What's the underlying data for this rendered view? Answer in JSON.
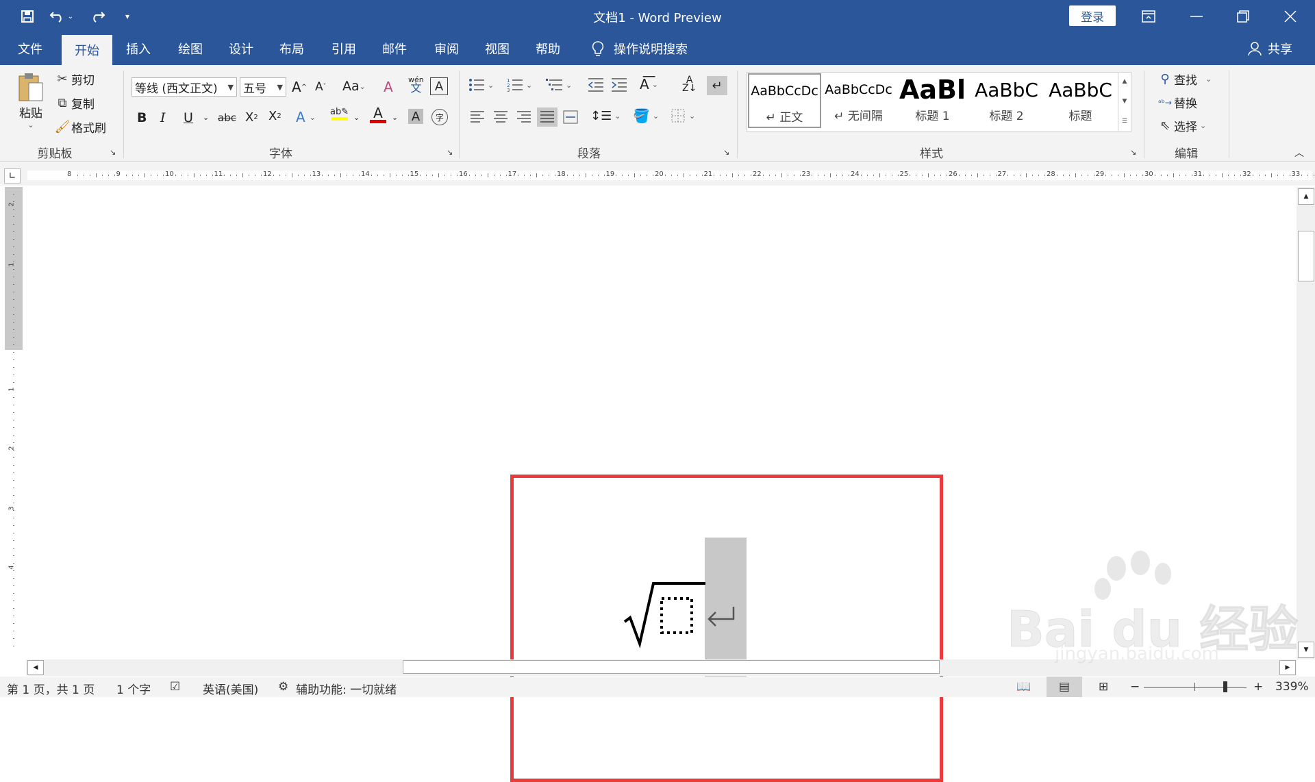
{
  "titlebar": {
    "title": "文档1  -  Word Preview",
    "login_label": "登录",
    "bg": "#2b579a"
  },
  "tabs": [
    "文件",
    "开始",
    "插入",
    "绘图",
    "设计",
    "布局",
    "引用",
    "邮件",
    "审阅",
    "视图",
    "帮助"
  ],
  "active_tab": "开始",
  "search_label": "操作说明搜索",
  "share_label": "共享",
  "clipboard": {
    "paste": "粘贴",
    "cut": "剪切",
    "copy": "复制",
    "format_painter": "格式刷",
    "group": "剪贴板"
  },
  "font": {
    "font_name": "等线 (西文正文)",
    "font_size": "五号",
    "change_case": "Aa",
    "group": "字体"
  },
  "paragraph": {
    "group": "段落"
  },
  "styles": {
    "group": "样式",
    "items": [
      {
        "sample": "AaBbCcDc",
        "name": "↵ 正文"
      },
      {
        "sample": "AaBbCcDc",
        "name": "↵ 无间隔"
      },
      {
        "sample": "AaBl",
        "name": "标题 1"
      },
      {
        "sample": "AaBbC",
        "name": "标题 2"
      },
      {
        "sample": "AaBbC",
        "name": "标题"
      }
    ]
  },
  "editing": {
    "find": "查找",
    "replace": "替换",
    "select": "选择",
    "group": "编辑"
  },
  "ruler_numbers": [
    "8",
    "9",
    "10",
    "11",
    "12",
    "13",
    "14",
    "15",
    "16",
    "17",
    "18",
    "19",
    "20",
    "21",
    "22",
    "23",
    "24",
    "25",
    "26",
    "27",
    "28",
    "29",
    "30",
    "31",
    "32",
    "33"
  ],
  "vruler_numbers": [
    "2",
    "1",
    "1",
    "2",
    "3",
    "4"
  ],
  "status": {
    "page": "第 1 页，共 1 页",
    "words": "1 个字",
    "language": "英语(美国)",
    "accessibility": "辅助功能: 一切就绪",
    "zoom": "339%"
  },
  "watermark": {
    "brand": "Bai du 经验",
    "url": "jingyan.baidu.com"
  },
  "colors": {
    "highlight_border": "#e83c3c",
    "accent": "#2b579a"
  }
}
